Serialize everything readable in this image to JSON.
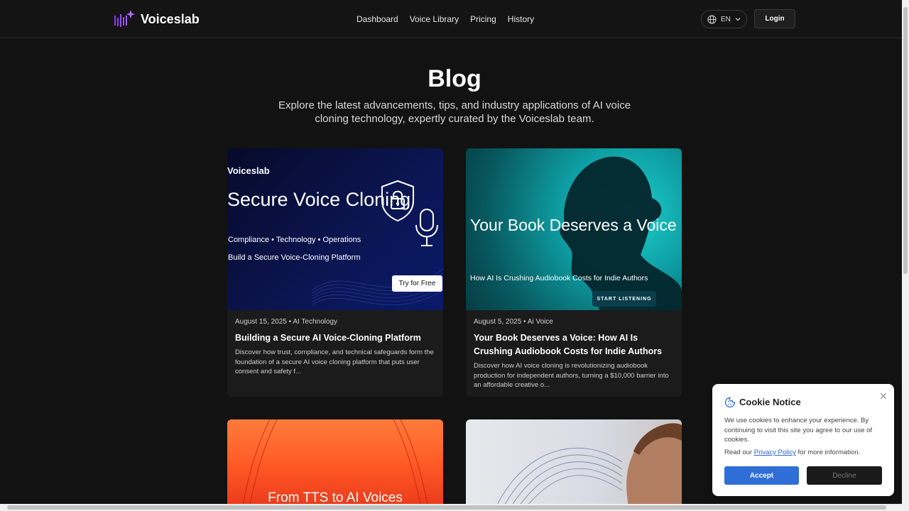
{
  "header": {
    "brand": "Voiceslab",
    "nav": [
      "Dashboard",
      "Voice Library",
      "Pricing",
      "History"
    ],
    "language": "EN",
    "login": "Login"
  },
  "hero": {
    "title": "Blog",
    "subtitle": "Explore the latest advancements, tips, and industry applications of AI voice cloning technology, expertly curated by the Voiceslab team."
  },
  "posts": [
    {
      "image": {
        "brand": "Voiceslab",
        "headline": "Secure Voice Cloning",
        "tagline": "Compliance • Technology • Operations",
        "caption": "Build a Secure Voice-Cloning Platform",
        "cta": "Try for Free"
      },
      "date": "August 15, 2025",
      "category": "AI Technology",
      "title": "Building a Secure AI Voice-Cloning Platform",
      "excerpt": "Discover how trust, compliance, and technical safeguards form the foundation of a secure AI voice cloning platform that puts user consent and safety f..."
    },
    {
      "image": {
        "headline": "Your Book Deserves a Voice",
        "caption": "How AI Is Crushing Audiobook Costs for Indie Authors",
        "cta": "START LISTENING"
      },
      "date": "August 5, 2025",
      "category": "Ai Voice",
      "title": "Your Book Deserves a Voice: How AI Is Crushing Audiobook Costs for Indie Authors",
      "excerpt": "Discover how AI voice cloning is revolutionizing audiobook production for independent authors, turning a $10,000 barrier into an affordable creative o..."
    },
    {
      "image": {
        "headline": "From TTS to AI Voices"
      }
    },
    {
      "image": {}
    }
  ],
  "cookie": {
    "title": "Cookie Notice",
    "text": "We use cookies to enhance your experience. By continuing to visit this site you agree to our use of cookies.",
    "read_prefix": "Read our",
    "policy_link": "Privacy Policy",
    "read_suffix": "for more information.",
    "accept": "Accept",
    "decline": "Decline"
  },
  "colors": {
    "background": "#121212",
    "accent": "#2f6ed6",
    "logo": "#8b3dff"
  }
}
